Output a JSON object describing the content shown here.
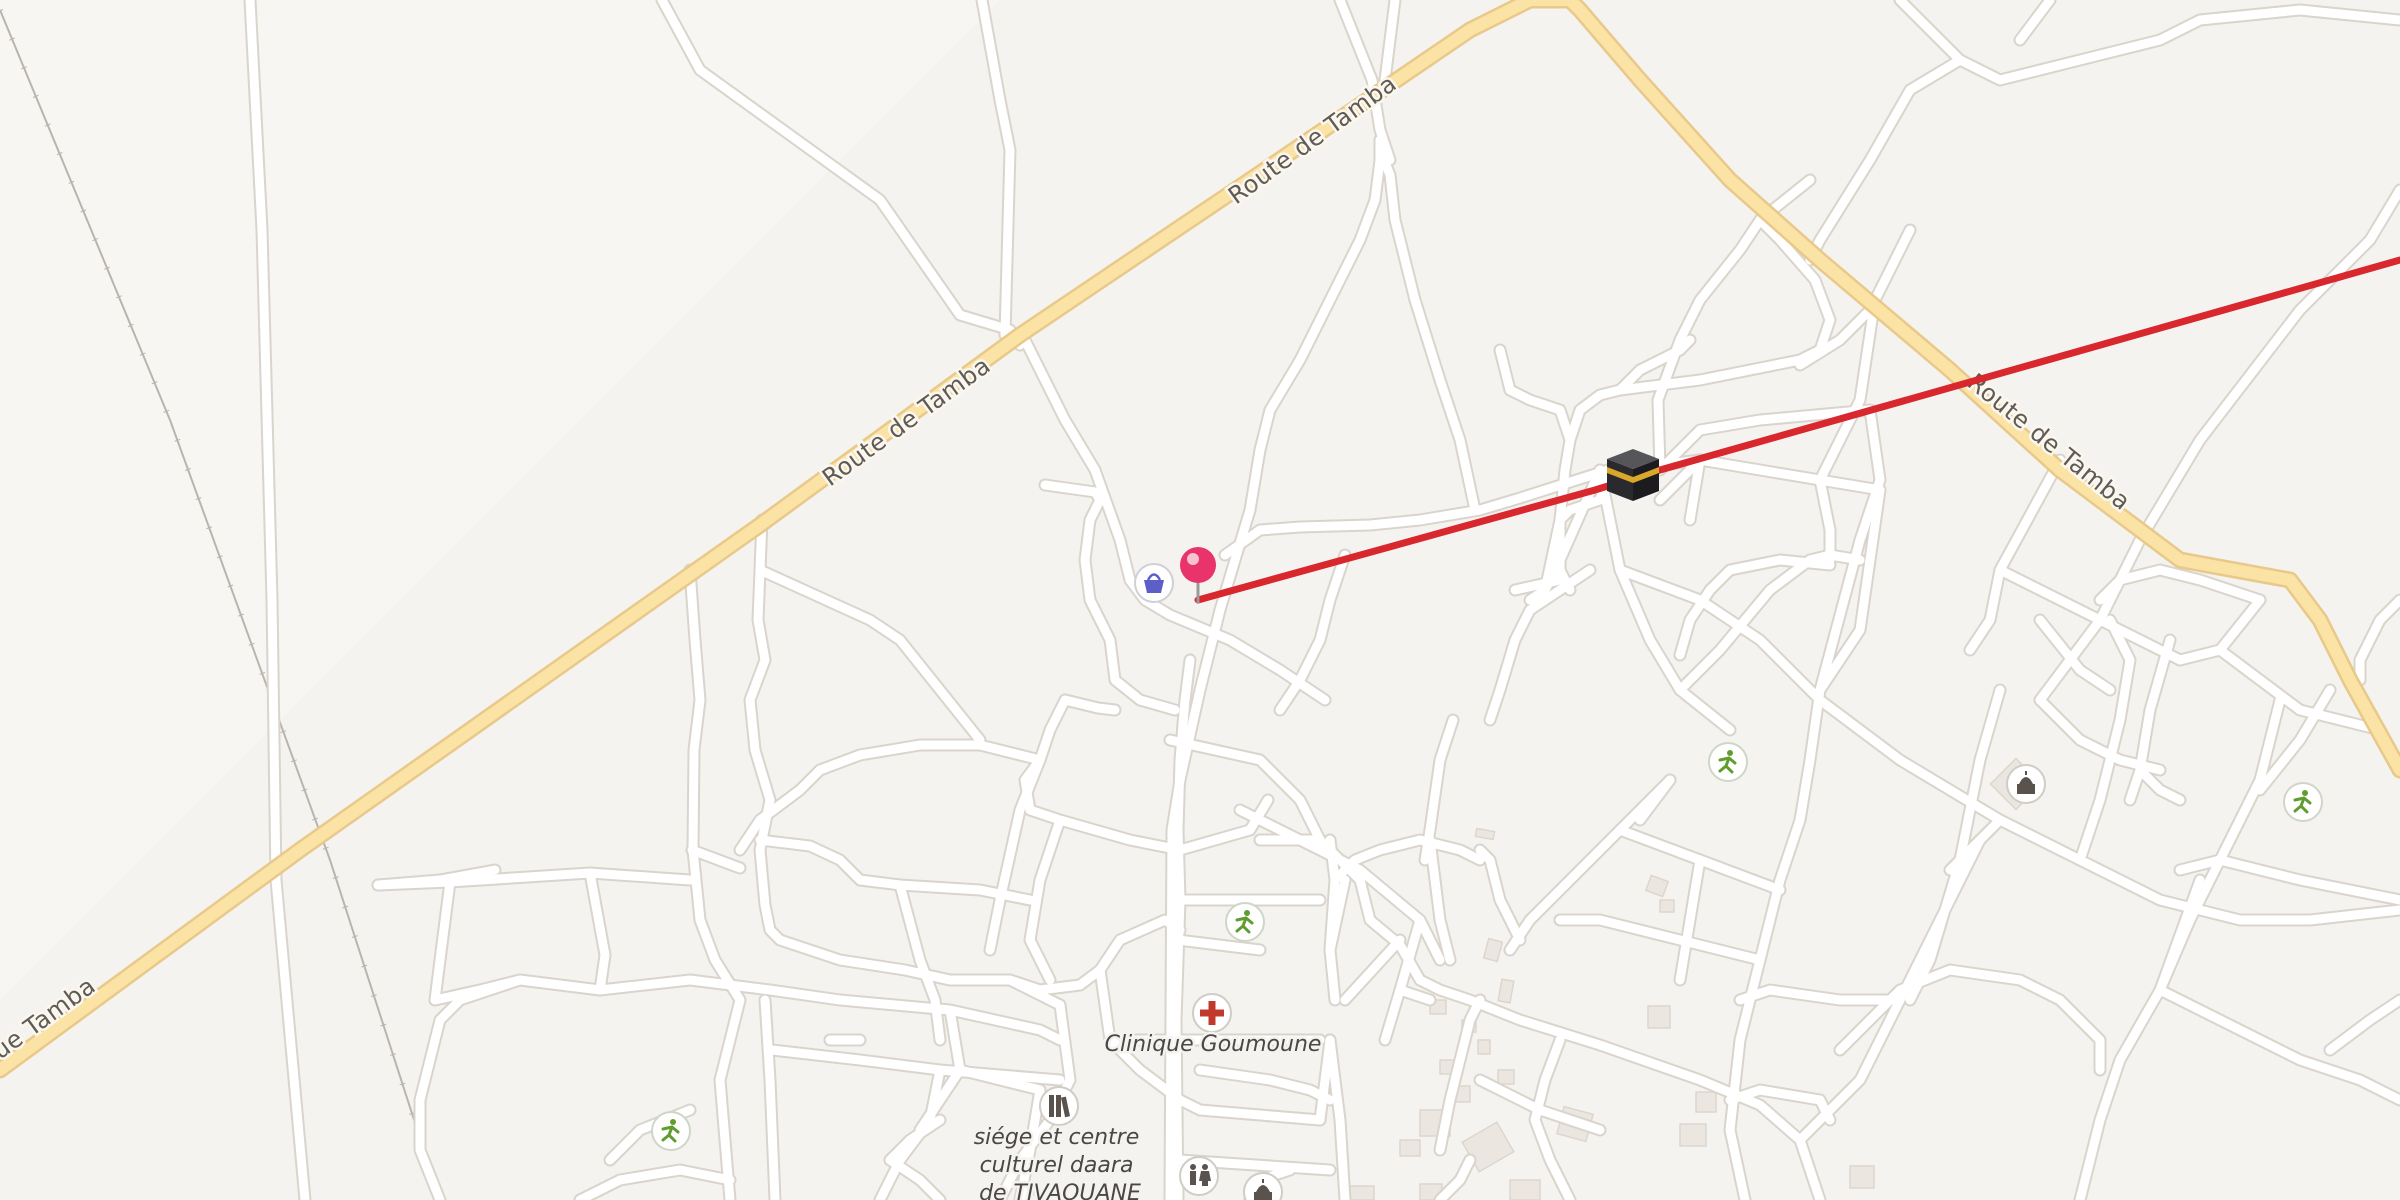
{
  "map": {
    "road_labels": [
      {
        "id": "route-de-tamba-a",
        "text": "Route de Tamba"
      },
      {
        "id": "route-de-tamba-b",
        "text": "Route de Tamba"
      },
      {
        "id": "route-de-tamba-c",
        "text": "Route de Tamba"
      },
      {
        "id": "route-de-tamba-d",
        "text": "ue Tamba"
      }
    ],
    "pois": {
      "clinic": {
        "label": "Clinique Goumoune",
        "icon": "hospital-cross-icon"
      },
      "cultural_center": {
        "label_lines": [
          "siége et centre",
          "culturel daara",
          "de TIVAOUANE"
        ],
        "icon": "library-icon"
      }
    },
    "markers": {
      "pin": {
        "icon": "map-pin-icon",
        "color": "#e8336b"
      },
      "kaaba": {
        "icon": "kaaba-icon"
      }
    },
    "route": {
      "color": "#d9272e"
    },
    "colors": {
      "background": "#f5f3f0",
      "primary_road": "#fbe3a6",
      "minor_road": "#ffffff",
      "sport_icon": "#5f9e2e",
      "clinic_icon": "#c0392b",
      "shop_icon": "#5b5fc7"
    }
  }
}
